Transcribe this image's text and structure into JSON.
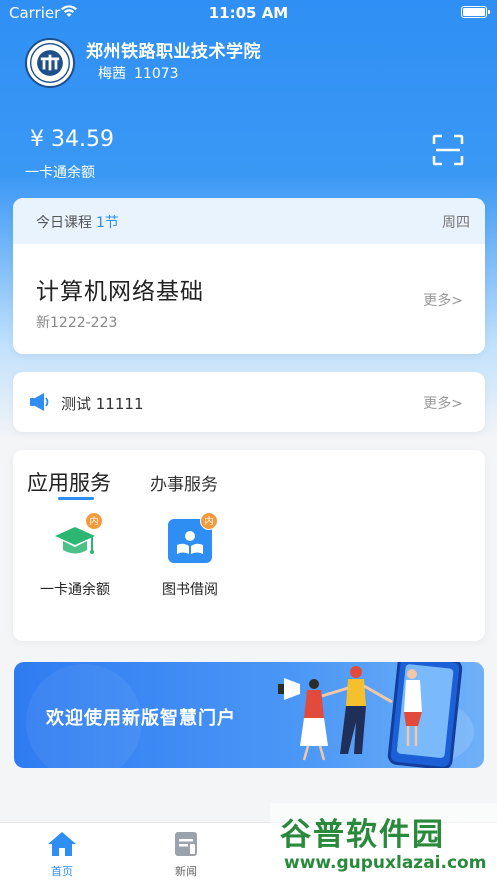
{
  "status_bar": {
    "carrier": "Carrier",
    "time": "11:05 AM"
  },
  "header": {
    "school_name": "郑州铁路职业技术学院",
    "user_name": "梅茜",
    "user_id": "11073",
    "balance": "¥ 34.59",
    "balance_label": "一卡通余额"
  },
  "course": {
    "header_label": "今日课程",
    "count": "1节",
    "weekday": "周四",
    "name": "计算机网络基础",
    "room": "新1222-223",
    "more": "更多>"
  },
  "notice": {
    "text": "测试 11111",
    "more": "更多>"
  },
  "services": {
    "tab_active": "应用服务",
    "tab_inactive": "办事服务",
    "apps": [
      {
        "label": "一卡通余额",
        "badge": "内",
        "icon": "graduation-cap-icon"
      },
      {
        "label": "图书借阅",
        "badge": "内",
        "icon": "library-book-icon"
      }
    ]
  },
  "banner": {
    "text": "欢迎使用新版智慧门户"
  },
  "tabbar": {
    "items": [
      {
        "label": "首页",
        "icon": "home-icon",
        "active": true
      },
      {
        "label": "新闻",
        "icon": "news-icon",
        "active": false
      }
    ]
  },
  "watermark": {
    "title": "谷普软件园",
    "url": "www.gupuxlazai.com"
  },
  "colors": {
    "accent": "#2e8ef3",
    "badge": "#f39a3a",
    "cap_green": "#2bb673"
  }
}
